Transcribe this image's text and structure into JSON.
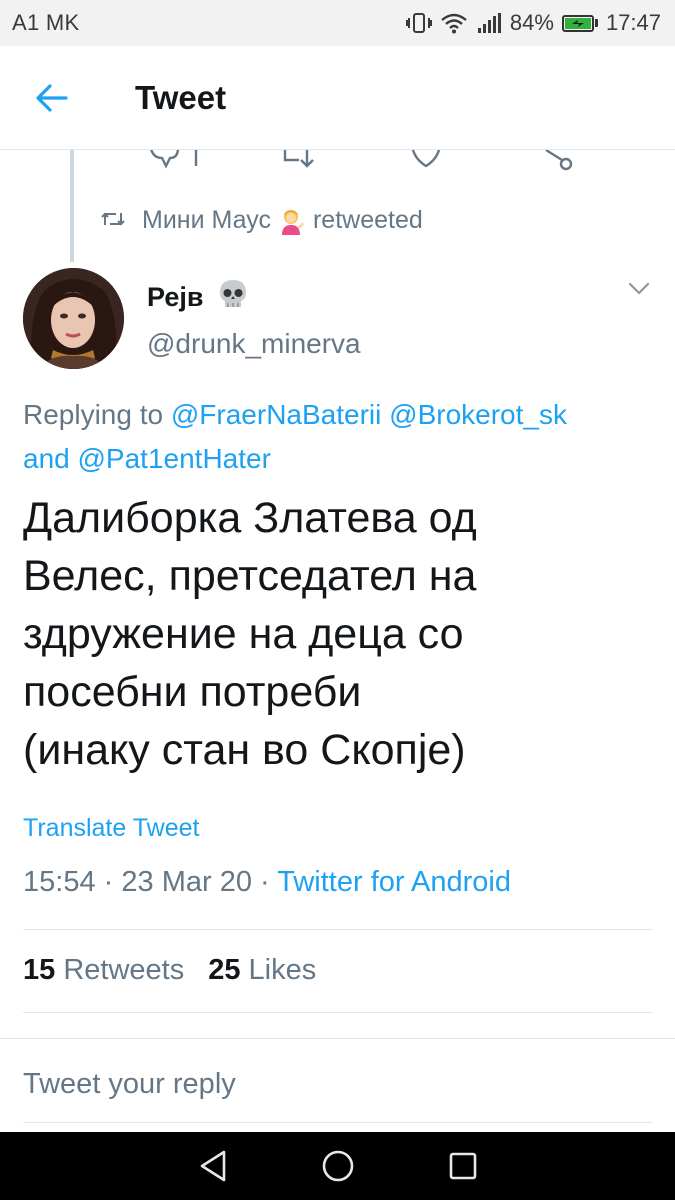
{
  "status_bar": {
    "carrier": "A1 MK",
    "battery_percent": "84%",
    "time": "17:47"
  },
  "header": {
    "title": "Tweet"
  },
  "retweet": {
    "user": "Мини Маус",
    "label": "retweeted"
  },
  "author": {
    "name": "Рејв",
    "handle": "@drunk_minerva"
  },
  "reply": {
    "prefix": "Replying to",
    "mentions": [
      "@FraerNaBaterii",
      "@Brokerot_sk",
      "@Pat1entHater"
    ],
    "joiner": "and"
  },
  "tweet": {
    "lines": [
      "Далиборка Златева од",
      "Велес, претседател на",
      "здружение на деца со",
      "посебни потреби",
      "(инаку стан во Скопје)"
    ],
    "translate_label": "Translate Tweet",
    "time": "15:54",
    "date": "23 Mar 20",
    "source": "Twitter for Android",
    "separator": "·"
  },
  "stats": {
    "retweets_count": "15",
    "retweets_label": "Retweets",
    "likes_count": "25",
    "likes_label": "Likes"
  },
  "reply_box": {
    "placeholder": "Tweet your reply"
  },
  "colors": {
    "accent": "#1da1f2",
    "secondary_text": "#657786",
    "primary_text": "#14171a",
    "divider": "#e1e8ed"
  },
  "icons": [
    "vibrate-icon",
    "wifi-icon",
    "signal-icon",
    "battery-icon",
    "back-arrow-icon",
    "retweet-icon",
    "person-tipping-hand-emoji",
    "skull-emoji",
    "chevron-down-icon",
    "nav-back-icon",
    "nav-home-icon",
    "nav-recents-icon"
  ]
}
